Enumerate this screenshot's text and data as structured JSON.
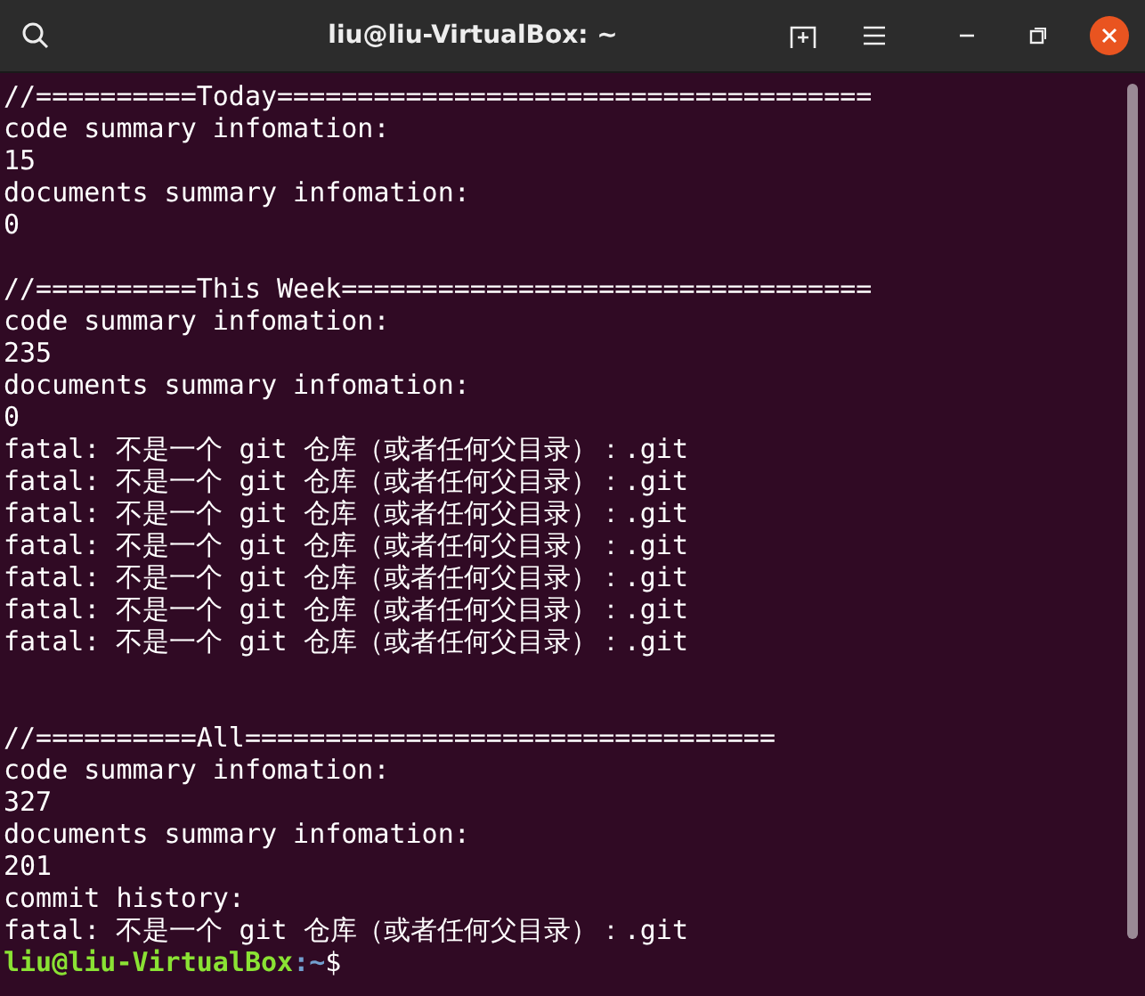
{
  "window": {
    "title": "liu@liu-VirtualBox: ~"
  },
  "terminal": {
    "lines": [
      {
        "kind": "output",
        "text": "//==========Today====================================="
      },
      {
        "kind": "output",
        "text": "code summary infomation:"
      },
      {
        "kind": "output",
        "text": "15"
      },
      {
        "kind": "output",
        "text": "documents summary infomation:"
      },
      {
        "kind": "output",
        "text": "0"
      },
      {
        "kind": "blank"
      },
      {
        "kind": "output",
        "text": "//==========This Week================================="
      },
      {
        "kind": "output",
        "text": "code summary infomation:"
      },
      {
        "kind": "output",
        "text": "235"
      },
      {
        "kind": "output",
        "text": "documents summary infomation:"
      },
      {
        "kind": "output",
        "text": "0"
      },
      {
        "kind": "output",
        "text": "fatal: 不是一个 git 仓库（或者任何父目录）：.git"
      },
      {
        "kind": "output",
        "text": "fatal: 不是一个 git 仓库（或者任何父目录）：.git"
      },
      {
        "kind": "output",
        "text": "fatal: 不是一个 git 仓库（或者任何父目录）：.git"
      },
      {
        "kind": "output",
        "text": "fatal: 不是一个 git 仓库（或者任何父目录）：.git"
      },
      {
        "kind": "output",
        "text": "fatal: 不是一个 git 仓库（或者任何父目录）：.git"
      },
      {
        "kind": "output",
        "text": "fatal: 不是一个 git 仓库（或者任何父目录）：.git"
      },
      {
        "kind": "output",
        "text": "fatal: 不是一个 git 仓库（或者任何父目录）：.git"
      },
      {
        "kind": "blank"
      },
      {
        "kind": "blank"
      },
      {
        "kind": "output",
        "text": "//==========All================================="
      },
      {
        "kind": "output",
        "text": "code summary infomation:"
      },
      {
        "kind": "output",
        "text": "327"
      },
      {
        "kind": "output",
        "text": "documents summary infomation:"
      },
      {
        "kind": "output",
        "text": "201"
      },
      {
        "kind": "output",
        "text": "commit history:"
      },
      {
        "kind": "output",
        "text": "fatal: 不是一个 git 仓库（或者任何父目录）：.git"
      },
      {
        "kind": "prompt",
        "user_host": "liu@liu-VirtualBox",
        "path": ":~",
        "symbol": "$"
      }
    ]
  }
}
